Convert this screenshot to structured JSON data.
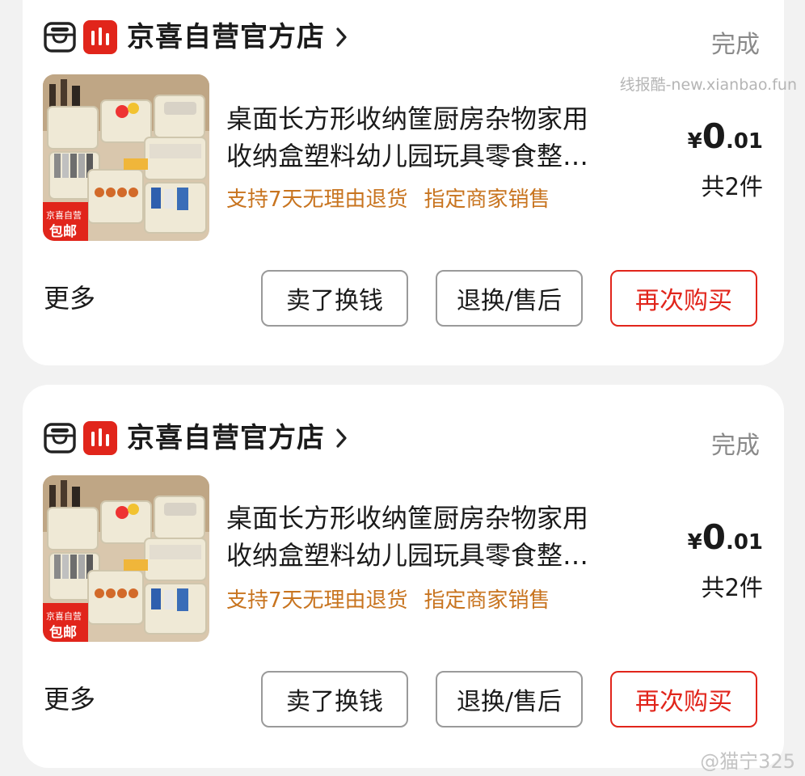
{
  "orders": [
    {
      "shop_name": "京喜自营官方店",
      "status": "完成",
      "title_line1": "桌面长方形收纳筐厨房杂物家用",
      "title_line2": "收纳盒塑料幼儿园玩具零食整…",
      "tag1": "支持7天无理由退货",
      "tag2": "指定商家销售",
      "price_symbol": "¥",
      "price_int": "0",
      "price_dec": ".01",
      "quantity": "共2件",
      "badge_top": "京喜自营",
      "badge_bottom": "包邮",
      "more": "更多",
      "btn_sell": "卖了换钱",
      "btn_return": "退换/售后",
      "btn_rebuy": "再次购买"
    },
    {
      "shop_name": "京喜自营官方店",
      "status": "完成",
      "title_line1": "桌面长方形收纳筐厨房杂物家用",
      "title_line2": "收纳盒塑料幼儿园玩具零食整…",
      "tag1": "支持7天无理由退货",
      "tag2": "指定商家销售",
      "price_symbol": "¥",
      "price_int": "0",
      "price_dec": ".01",
      "quantity": "共2件",
      "badge_top": "京喜自营",
      "badge_bottom": "包邮",
      "more": "更多",
      "btn_sell": "卖了换钱",
      "btn_return": "退换/售后",
      "btn_rebuy": "再次购买"
    }
  ],
  "watermark_top": "线报酷-new.xianbao.fun",
  "watermark_bottom": "@猫宁325",
  "colors": {
    "accent_red": "#e1251b",
    "tag_orange": "#c8741f",
    "status_gray": "#8a8a8a"
  },
  "icons": [
    "store-icon",
    "brand-logo-icon",
    "chevron-right-icon"
  ]
}
